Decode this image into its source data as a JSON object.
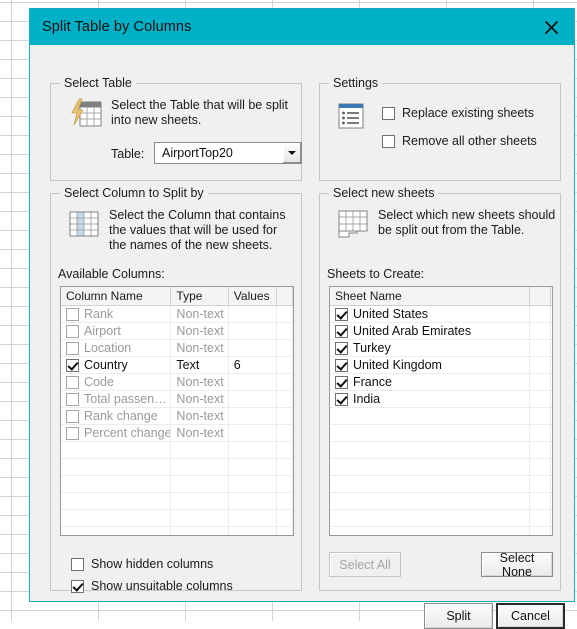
{
  "window": {
    "title": "Split Table by Columns",
    "close_icon": "close-icon",
    "accent_color": "#00b0c6"
  },
  "select_table": {
    "legend": "Select Table",
    "icon": "table-lightning-icon",
    "description": "Select the Table that will be split into new sheets.",
    "table_label": "Table:",
    "table_value": "AirportTop20",
    "dropdown_icon": "chevron-down-icon"
  },
  "settings": {
    "legend": "Settings",
    "icon": "list-settings-icon",
    "options": [
      {
        "label": "Replace existing sheets",
        "checked": false
      },
      {
        "label": "Remove all other sheets",
        "checked": false
      }
    ]
  },
  "select_column": {
    "legend": "Select Column to Split by",
    "icon": "column-grid-icon",
    "description": "Select the Column that contains the values that will be used for the names of the new sheets.",
    "list_label": "Available Columns:",
    "headers": [
      "Column Name",
      "Type",
      "Values",
      ""
    ],
    "rows": [
      {
        "name": "Rank",
        "type": "Non-text",
        "values": "",
        "checked": false,
        "enabled": false
      },
      {
        "name": "Airport",
        "type": "Non-text",
        "values": "",
        "checked": false,
        "enabled": false
      },
      {
        "name": "Location",
        "type": "Non-text",
        "values": "",
        "checked": false,
        "enabled": false
      },
      {
        "name": "Country",
        "type": "Text",
        "values": "6",
        "checked": true,
        "enabled": true
      },
      {
        "name": "Code",
        "type": "Non-text",
        "values": "",
        "checked": false,
        "enabled": false
      },
      {
        "name": "Total passen…",
        "type": "Non-text",
        "values": "",
        "checked": false,
        "enabled": false
      },
      {
        "name": "Rank change",
        "type": "Non-text",
        "values": "",
        "checked": false,
        "enabled": false
      },
      {
        "name": "Percent change",
        "type": "Non-text",
        "values": "",
        "checked": false,
        "enabled": false
      }
    ],
    "empty_row_count": 8,
    "footer_options": [
      {
        "label": "Show hidden columns",
        "checked": false
      },
      {
        "label": "Show unsuitable columns",
        "checked": true
      }
    ]
  },
  "select_sheets": {
    "legend": "Select new sheets",
    "icon": "sheet-split-icon",
    "description": "Select which new sheets should be split out from the Table.",
    "list_label": "Sheets to Create:",
    "headers": [
      "Sheet Name",
      ""
    ],
    "rows": [
      {
        "name": "United States",
        "checked": true
      },
      {
        "name": "United Arab Emirates",
        "checked": true
      },
      {
        "name": "Turkey",
        "checked": true
      },
      {
        "name": "United Kingdom",
        "checked": true
      },
      {
        "name": "France",
        "checked": true
      },
      {
        "name": "India",
        "checked": true
      }
    ],
    "empty_row_count": 9,
    "select_all_label": "Select All",
    "select_all_enabled": false,
    "select_none_label": "Select None",
    "select_none_enabled": true
  },
  "footer": {
    "split_label": "Split",
    "cancel_label": "Cancel"
  }
}
